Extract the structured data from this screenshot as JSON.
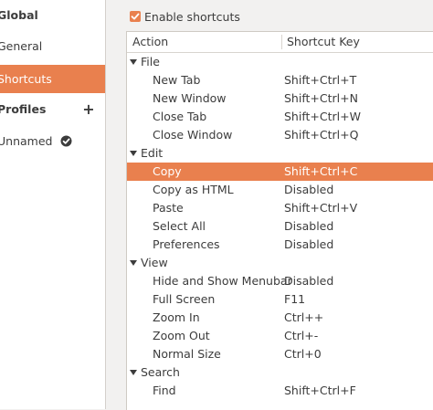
{
  "sidebar": {
    "global_heading": "Global",
    "items": [
      {
        "label": "General",
        "selected": false
      },
      {
        "label": "Shortcuts",
        "selected": true
      }
    ],
    "profiles_heading": "Profiles",
    "add_label": "+",
    "profiles": [
      {
        "label": "Unnamed",
        "default_icon": "check-circle-icon"
      }
    ]
  },
  "shortcuts": {
    "enable_label": "Enable shortcuts",
    "enabled": true,
    "columns": {
      "action": "Action",
      "key": "Shortcut Key"
    },
    "groups": [
      {
        "name": "File",
        "rows": [
          {
            "action": "New Tab",
            "key": "Shift+Ctrl+T"
          },
          {
            "action": "New Window",
            "key": "Shift+Ctrl+N"
          },
          {
            "action": "Close Tab",
            "key": "Shift+Ctrl+W"
          },
          {
            "action": "Close Window",
            "key": "Shift+Ctrl+Q"
          }
        ]
      },
      {
        "name": "Edit",
        "rows": [
          {
            "action": "Copy",
            "key": "Shift+Ctrl+C",
            "selected": true
          },
          {
            "action": "Copy as HTML",
            "key": "Disabled"
          },
          {
            "action": "Paste",
            "key": "Shift+Ctrl+V"
          },
          {
            "action": "Select All",
            "key": "Disabled"
          },
          {
            "action": "Preferences",
            "key": "Disabled"
          }
        ]
      },
      {
        "name": "View",
        "rows": [
          {
            "action": "Hide and Show Menubar",
            "key": "Disabled"
          },
          {
            "action": "Full Screen",
            "key": "F11"
          },
          {
            "action": "Zoom In",
            "key": "Ctrl++"
          },
          {
            "action": "Zoom Out",
            "key": "Ctrl+-"
          },
          {
            "action": "Normal Size",
            "key": "Ctrl+0"
          }
        ]
      },
      {
        "name": "Search",
        "rows": [
          {
            "action": "Find",
            "key": "Shift+Ctrl+F"
          }
        ]
      }
    ]
  },
  "colors": {
    "accent": "#e9804e",
    "background": "#f2f1f0",
    "text": "#3c3c3c"
  }
}
